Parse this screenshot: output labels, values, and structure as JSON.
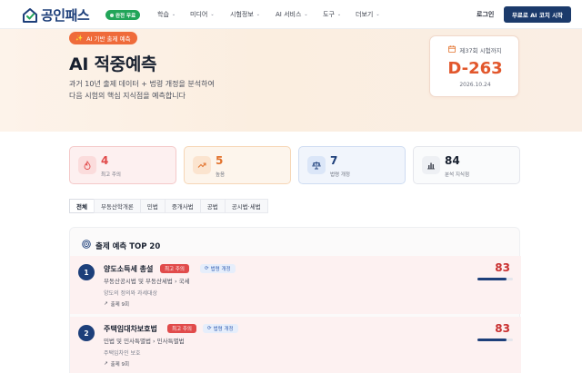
{
  "nav": {
    "logo_text": "공인패스",
    "free_badge": "완전 무료",
    "menu": [
      {
        "label": "학습",
        "has_dropdown": true
      },
      {
        "label": "미디어",
        "has_dropdown": true
      },
      {
        "label": "시험정보",
        "has_dropdown": true
      },
      {
        "label": "AI 서비스",
        "has_dropdown": true
      },
      {
        "label": "도구",
        "has_dropdown": true
      },
      {
        "label": "더보기",
        "has_dropdown": true
      }
    ],
    "login_label": "로그인",
    "cta_label": "무료로 AI 코치 시작"
  },
  "hero": {
    "tag": "AI 기반 출제 예측",
    "title": "AI 적중예측",
    "subtitle_line1": "과거 10년 출제 데이터 + 법령 개정을 분석하여",
    "subtitle_line2": "다음 시험의 핵심 지식점을 예측합니다",
    "dday": {
      "label": "제37회 시험까지",
      "value": "D-263",
      "date": "2026.10.24"
    }
  },
  "stats": [
    {
      "value": "4",
      "label": "최고 주의",
      "icon": "fire-icon",
      "color": "#e14b4b",
      "bg": "#fdf0f0",
      "border": "#f4c9c9",
      "icon_bg": "#fbdcdc"
    },
    {
      "value": "5",
      "label": "높음",
      "icon": "trending-up-icon",
      "color": "#e2722c",
      "bg": "#fdf5ec",
      "border": "#f6d6b6",
      "icon_bg": "#fbe4cf"
    },
    {
      "value": "7",
      "label": "법령 개정",
      "icon": "scale-icon",
      "color": "#1d3f7a",
      "bg": "#f1f5fc",
      "border": "#cfdcf2",
      "icon_bg": "#dbe6f8"
    },
    {
      "value": "84",
      "label": "분석 지식점",
      "icon": "bar-chart-icon",
      "color": "#18202f",
      "bg": "#fafbfc",
      "border": "#e4e6ec",
      "icon_bg": "#eef0f4"
    }
  ],
  "tabs": [
    "전체",
    "부동산학개론",
    "민법",
    "중개사법",
    "공법",
    "공시법·세법"
  ],
  "active_tab": "전체",
  "panel": {
    "title": "출제 예측 TOP 20",
    "rows": [
      {
        "rank": "1",
        "title": "양도소득세 총설",
        "priority": "최고 주의",
        "law_change": "법령 개정",
        "subject": "부동산공시법 및 부동산세법 › 국세",
        "topic": "양도의 정의와 과세대상",
        "count": "출제 9회",
        "score": "83",
        "progress": 0.83
      },
      {
        "rank": "2",
        "title": "주택임대차보호법",
        "priority": "최고 주의",
        "law_change": "법령 개정",
        "subject": "민법 및 민사특별법 › 민사특별법",
        "topic": "주택임차인 보호",
        "count": "출제 9회",
        "score": "83",
        "progress": 0.83
      }
    ]
  },
  "colors": {
    "brand_navy": "#1d3f7a",
    "accent_orange": "#ef6b3a",
    "danger_red": "#e14b4b",
    "free_green": "#22a559"
  }
}
